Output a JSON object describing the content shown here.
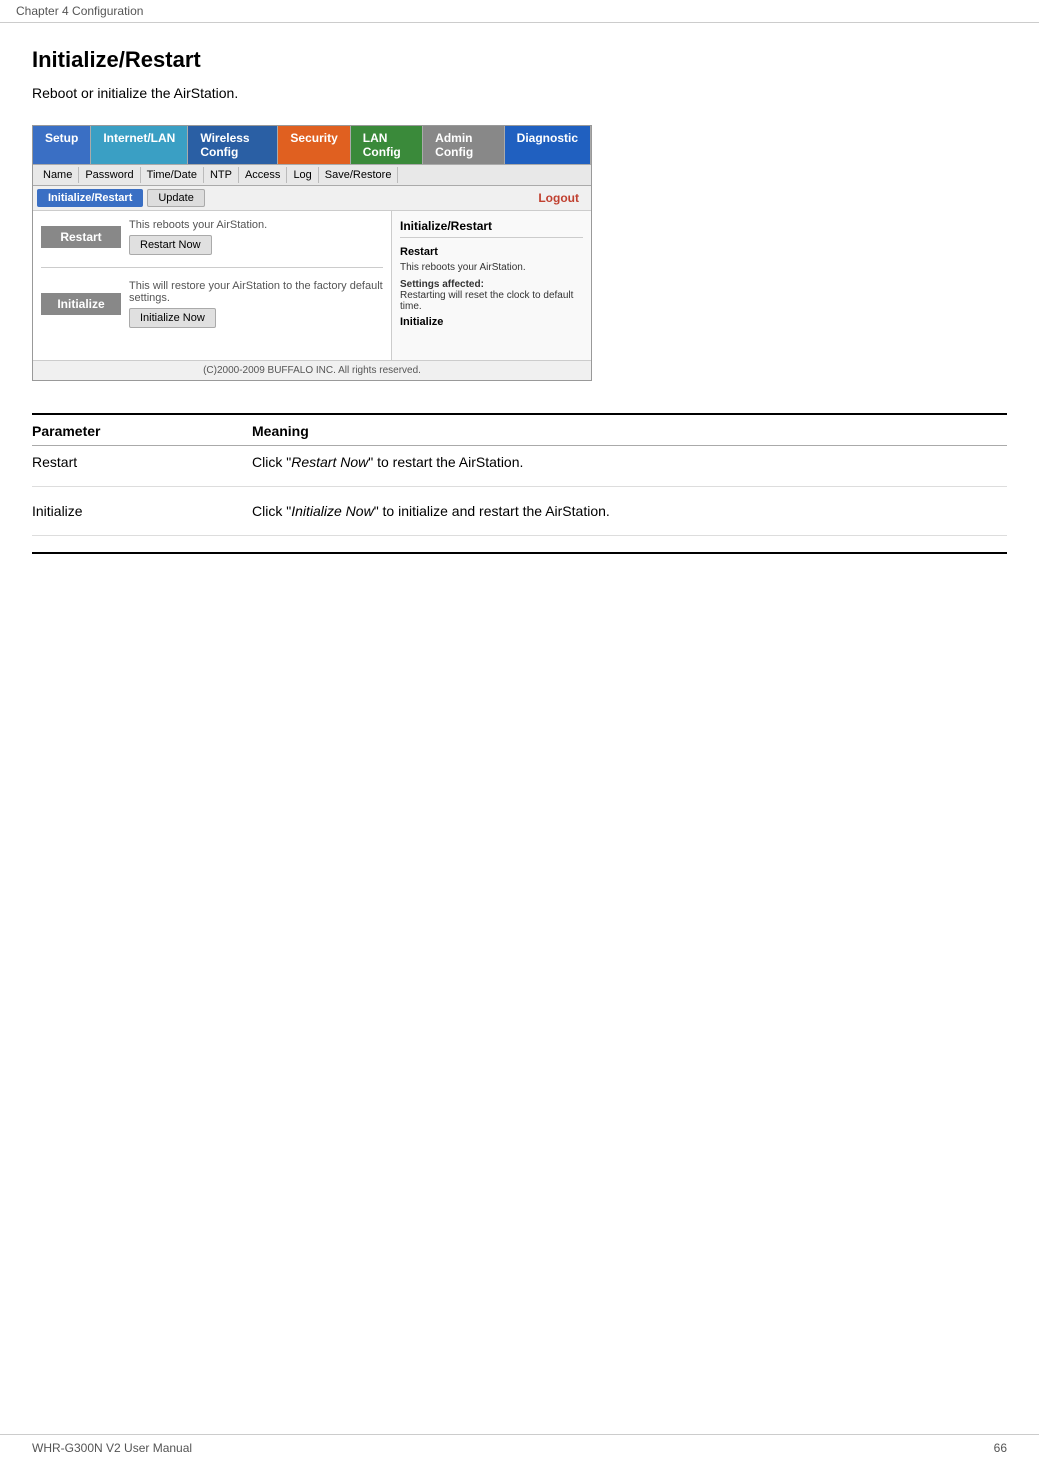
{
  "header": {
    "chapter": "Chapter 4  Configuration"
  },
  "footer": {
    "manual": "WHR-G300N V2 User Manual",
    "page": "66"
  },
  "page": {
    "title": "Initialize/Restart",
    "subtitle": "Reboot or initialize the AirStation."
  },
  "router_ui": {
    "nav_tabs_1": [
      {
        "label": "Setup",
        "style": "blue"
      },
      {
        "label": "Internet/LAN",
        "style": "teal"
      },
      {
        "label": "Wireless Config",
        "style": "dark-blue"
      },
      {
        "label": "Security",
        "style": "orange"
      },
      {
        "label": "LAN Config",
        "style": "green"
      },
      {
        "label": "Admin Config",
        "style": "gray"
      },
      {
        "label": "Diagnostic",
        "style": "diag"
      }
    ],
    "nav_tabs_2": [
      {
        "label": "Name",
        "active": false
      },
      {
        "label": "Password",
        "active": false
      },
      {
        "label": "Time/Date",
        "active": false
      },
      {
        "label": "NTP",
        "active": false
      },
      {
        "label": "Access",
        "active": false
      },
      {
        "label": "Log",
        "active": false
      },
      {
        "label": "Save/Restore",
        "active": false
      }
    ],
    "sub_tabs": [
      {
        "label": "Initialize/Restart",
        "active": true
      },
      {
        "label": "Update",
        "active": false
      }
    ],
    "logout_label": "Logout",
    "restart_section": {
      "label": "Restart",
      "description": "This reboots your AirStation.",
      "button": "Restart Now"
    },
    "initialize_section": {
      "label": "Initialize",
      "description": "This will restore your AirStation to the factory default settings.",
      "button": "Initialize Now"
    },
    "footer_text": "(C)2000-2009 BUFFALO INC. All rights reserved.",
    "right_panel": {
      "title": "Initialize/Restart",
      "restart_label": "Restart",
      "restart_desc": "This reboots your AirStation.",
      "settings_label": "Settings affected:",
      "settings_detail": "Restarting will reset the clock to default time.",
      "initialize_label": "Initialize"
    }
  },
  "parameters": {
    "header_col1": "Parameter",
    "header_col2": "Meaning",
    "rows": [
      {
        "name": "Restart",
        "meaning_prefix": "Click \"",
        "meaning_italic": "Restart Now",
        "meaning_suffix": "\" to restart the AirStation."
      },
      {
        "name": "Initialize",
        "meaning_prefix": "Click \"",
        "meaning_italic": "Initialize Now",
        "meaning_suffix": "\" to initialize and restart the AirStation."
      }
    ]
  }
}
